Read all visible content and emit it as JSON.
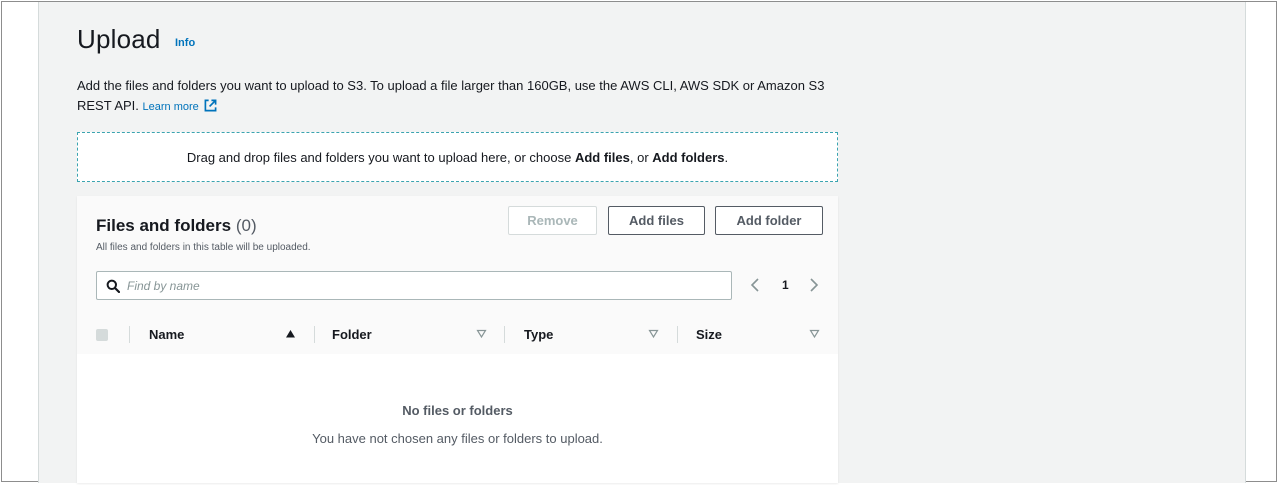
{
  "header": {
    "title": "Upload",
    "info_link": "Info",
    "description": "Add the files and folders you want to upload to S3. To upload a file larger than 160GB, use the AWS CLI, AWS SDK or Amazon S3 REST API.",
    "learn_more": "Learn more",
    "learn_more_icon": "external-link-icon"
  },
  "dropzone": {
    "text_before": "Drag and drop files and folders you want to upload here, or choose ",
    "add_files": "Add files",
    "separator": ", or ",
    "add_folders": "Add folders",
    "text_after": "."
  },
  "panel": {
    "title": "Files and folders",
    "count": "(0)",
    "subtitle": "All files and folders in this table will be uploaded.",
    "buttons": {
      "remove": "Remove",
      "add_files": "Add files",
      "add_folder": "Add folder"
    },
    "search": {
      "placeholder": "Find by name",
      "value": "",
      "icon": "search-icon"
    },
    "pagination": {
      "current_page": "1",
      "prev_icon": "chevron-left-icon",
      "next_icon": "chevron-right-icon"
    },
    "columns": [
      {
        "label": "Name",
        "sort": "ascending"
      },
      {
        "label": "Folder",
        "sort": "none"
      },
      {
        "label": "Type",
        "sort": "none"
      },
      {
        "label": "Size",
        "sort": "none"
      }
    ],
    "empty": {
      "title": "No files or folders",
      "description": "You have not chosen any files or folders to upload."
    }
  },
  "colors": {
    "link": "#0073bb",
    "dropzone_border": "#3ba4b0",
    "page_background": "#f2f3f3",
    "panel_header": "#fafafa",
    "disabled_text": "#aab7b8",
    "secondary_text": "#545b64"
  }
}
